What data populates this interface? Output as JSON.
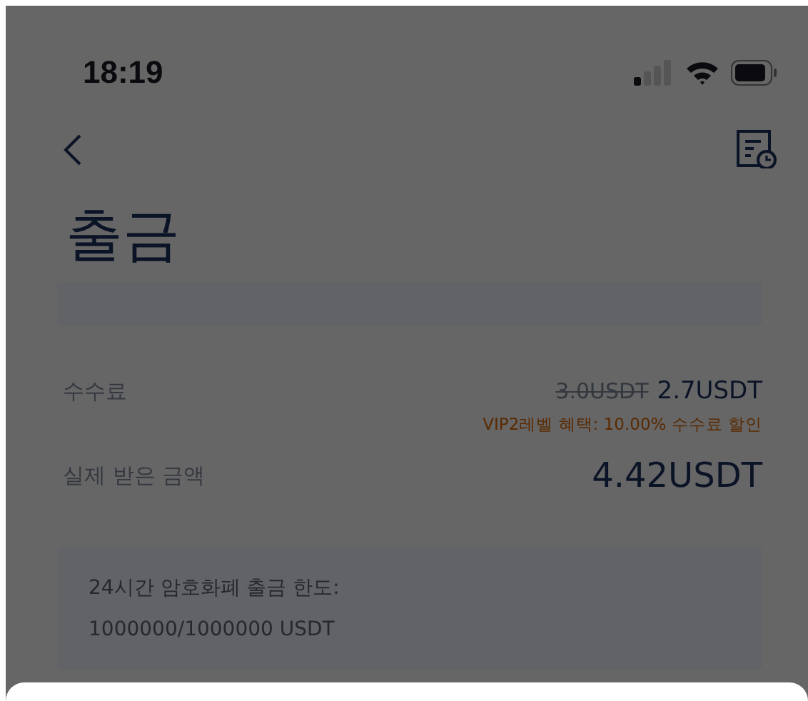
{
  "status_bar": {
    "time": "18:19"
  },
  "header": {
    "title": "출금"
  },
  "fee": {
    "label": "수수료",
    "original": "3.0USDT",
    "value": "2.7USDT",
    "discount_note": "VIP2레벨 혜택: 10.00% 수수료 할인"
  },
  "received": {
    "label": "실제 받은 금액",
    "value": "4.42USDT"
  },
  "limit_card": {
    "lines": [
      "24시간 암호화폐 출금 한도:",
      "1000000/1000000 USDT"
    ]
  },
  "bottom_sheet": {
    "open": true
  }
}
